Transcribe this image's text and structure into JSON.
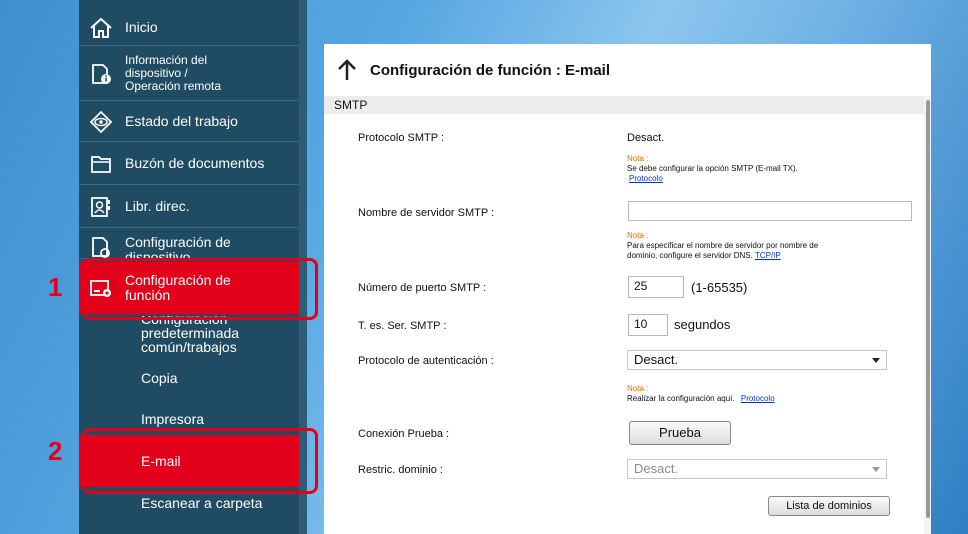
{
  "sidebar": {
    "items": [
      {
        "label": "Inicio",
        "icon": "home-icon"
      },
      {
        "label": "Información del dispositivo / Operación remota",
        "lines": [
          "Información del",
          "dispositivo /",
          "Operación remota"
        ],
        "icon": "device-info-icon"
      },
      {
        "label": "Estado del trabajo",
        "icon": "eye-icon"
      },
      {
        "label": "Buzón de documentos",
        "icon": "folder-icon"
      },
      {
        "label": "Libr. direc.",
        "icon": "address-book-icon"
      },
      {
        "label": "Configuración de dispositivo",
        "lines": [
          "Configuración de",
          "dispositivo"
        ],
        "icon": "device-settings-icon"
      },
      {
        "label": "Configuración de función",
        "lines": [
          "Configuración de",
          "función"
        ],
        "icon": "function-settings-icon"
      }
    ],
    "sub_items": [
      {
        "label": "Configuración predeterminada común/trabajos",
        "lines": [
          "Configuración",
          "predeterminada",
          "común/trabajos"
        ]
      },
      {
        "label": "Copia"
      },
      {
        "label": "Impresora"
      },
      {
        "label": "E-mail"
      },
      {
        "label": "Escanear a carpeta"
      }
    ]
  },
  "callouts": [
    "1",
    "2"
  ],
  "panel": {
    "title": "Configuración de función : E-mail",
    "section": "SMTP",
    "fields": {
      "protocol": {
        "label": "Protocolo SMTP :",
        "value": "Desact."
      },
      "note1": {
        "title": "Nota :",
        "text": "Se debe configurar la opción SMTP (E-mail TX).",
        "link": "Protocolo"
      },
      "server": {
        "label": "Nombre de servidor SMTP :",
        "value": ""
      },
      "note2": {
        "title": "Nota :",
        "line1": "Para especificar el nombre de servidor por nombre de",
        "line2": "dominio, configure el servidor DNS.",
        "link": "TCP/IP"
      },
      "port": {
        "label": "Número de puerto SMTP :",
        "value": "25",
        "range": "(1-65535)"
      },
      "timeout": {
        "label": "T. es. Ser. SMTP :",
        "value": "10",
        "unit": "segundos"
      },
      "auth": {
        "label": "Protocolo de autenticación :",
        "value": "Desact."
      },
      "note3": {
        "title": "Nota :",
        "text": "Realizar la configuración aquí.",
        "link": "Protocolo"
      },
      "test": {
        "label": "Conexión Prueba :",
        "button": "Prueba"
      },
      "domain": {
        "label": "Restric. dominio :",
        "value": "Desact."
      },
      "domain_list_button": "Lista de dominios"
    }
  },
  "colors": {
    "accent": "#e3001b",
    "sidebar": "#1f4b63",
    "note": "#e07000",
    "link": "#0033cc"
  }
}
